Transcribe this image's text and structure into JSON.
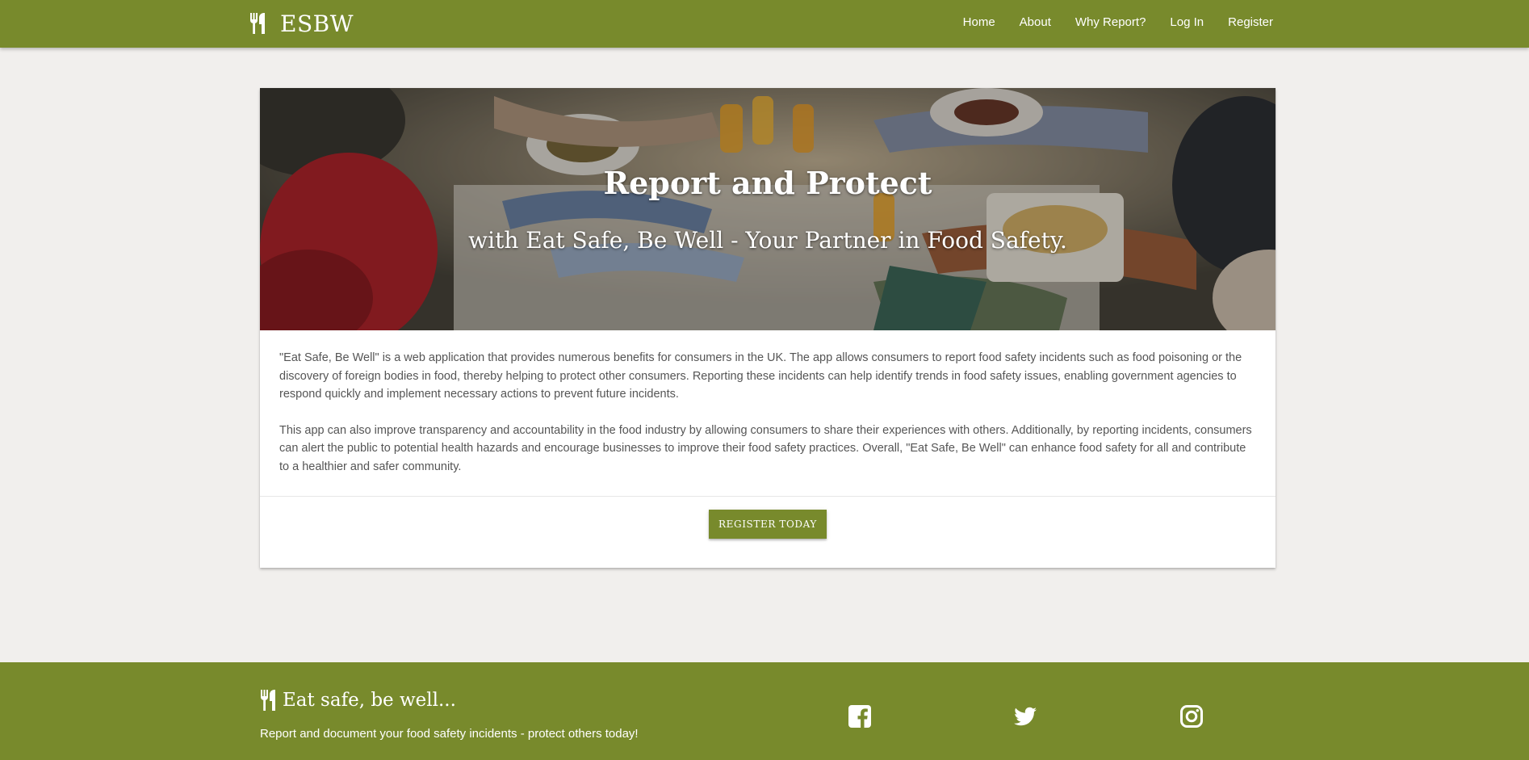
{
  "nav": {
    "brand": "ESBW",
    "links": [
      "Home",
      "About",
      "Why Report?",
      "Log In",
      "Register"
    ]
  },
  "hero": {
    "title": "Report and Protect",
    "subtitle": "with Eat Safe, Be Well - Your Partner in Food Safety."
  },
  "content": {
    "paragraphs": [
      "\"Eat Safe, Be Well\" is a web application that provides numerous benefits for consumers in the UK. The app allows consumers to report food safety incidents such as food poisoning or the discovery of foreign bodies in food, thereby helping to protect other consumers. Reporting these incidents can help identify trends in food safety issues, enabling government agencies to respond quickly and implement necessary actions to prevent future incidents.",
      "This app can also improve transparency and accountability in the food industry by allowing consumers to share their experiences with others. Additionally, by reporting incidents, consumers can alert the public to potential health hazards and encourage businesses to improve their food safety practices. Overall, \"Eat Safe, Be Well\" can enhance food safety for all and contribute to a healthier and safer community."
    ],
    "button": "REGISTER TODAY"
  },
  "footer": {
    "title": "Eat safe, be well...",
    "tagline": "Report and document your food safety incidents - protect others today!",
    "social": [
      "facebook-icon",
      "twitter-icon",
      "instagram-icon"
    ]
  },
  "colors": {
    "primary": "#788a2c",
    "background": "#f1efed"
  }
}
